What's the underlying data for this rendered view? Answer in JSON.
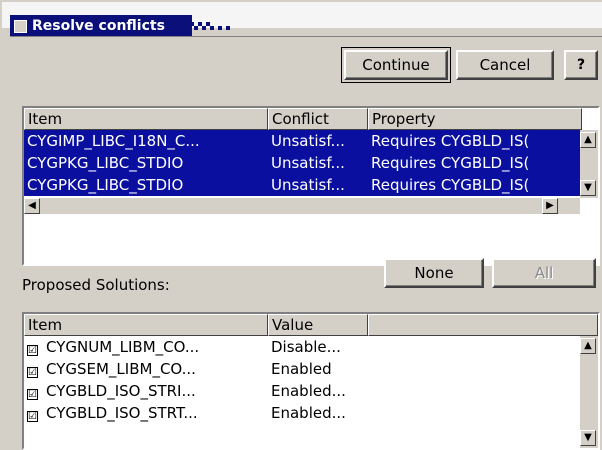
{
  "window": {
    "title": "Resolve conflicts"
  },
  "buttons": {
    "continue": "Continue",
    "cancel": "Cancel",
    "help": "?",
    "none": "None",
    "all": "All"
  },
  "conflicts": {
    "headers": [
      "Item",
      "Conflict",
      "Property"
    ],
    "rows": [
      {
        "item": "CYGIMP_LIBC_I18N_C...",
        "conflict": "Unsatisf...",
        "property": "Requires  CYGBLD_IS(",
        "selected": true
      },
      {
        "item": "CYGPKG_LIBC_STDIO",
        "conflict": "Unsatisf...",
        "property": "Requires  CYGBLD_IS(",
        "selected": true
      },
      {
        "item": "CYGPKG_LIBC_STDIO",
        "conflict": "Unsatisf...",
        "property": "Requires  CYGBLD_IS(",
        "selected": true
      }
    ]
  },
  "solutions": {
    "label": "Proposed Solutions:",
    "headers": [
      "Item",
      "Value"
    ],
    "rows": [
      {
        "item": "CYGNUM_LIBM_CO...",
        "value": "Disable...",
        "checked": true
      },
      {
        "item": "CYGSEM_LIBM_CO...",
        "value": "Enabled",
        "checked": true
      },
      {
        "item": "CYGBLD_ISO_STRI...",
        "value": "Enabled...",
        "checked": true
      },
      {
        "item": "CYGBLD_ISO_STRT...",
        "value": "Enabled...",
        "checked": true
      }
    ]
  },
  "icons": {
    "checkbox": "☑",
    "scroll_up": "up-arrow-icon",
    "scroll_down": "down-arrow-icon",
    "scroll_left": "left-arrow-icon",
    "scroll_right": "right-arrow-icon"
  },
  "colors": {
    "title_bar": "#0a0f7a",
    "selection": "#0a0fa0",
    "window_bg": "#d4d0c8"
  }
}
